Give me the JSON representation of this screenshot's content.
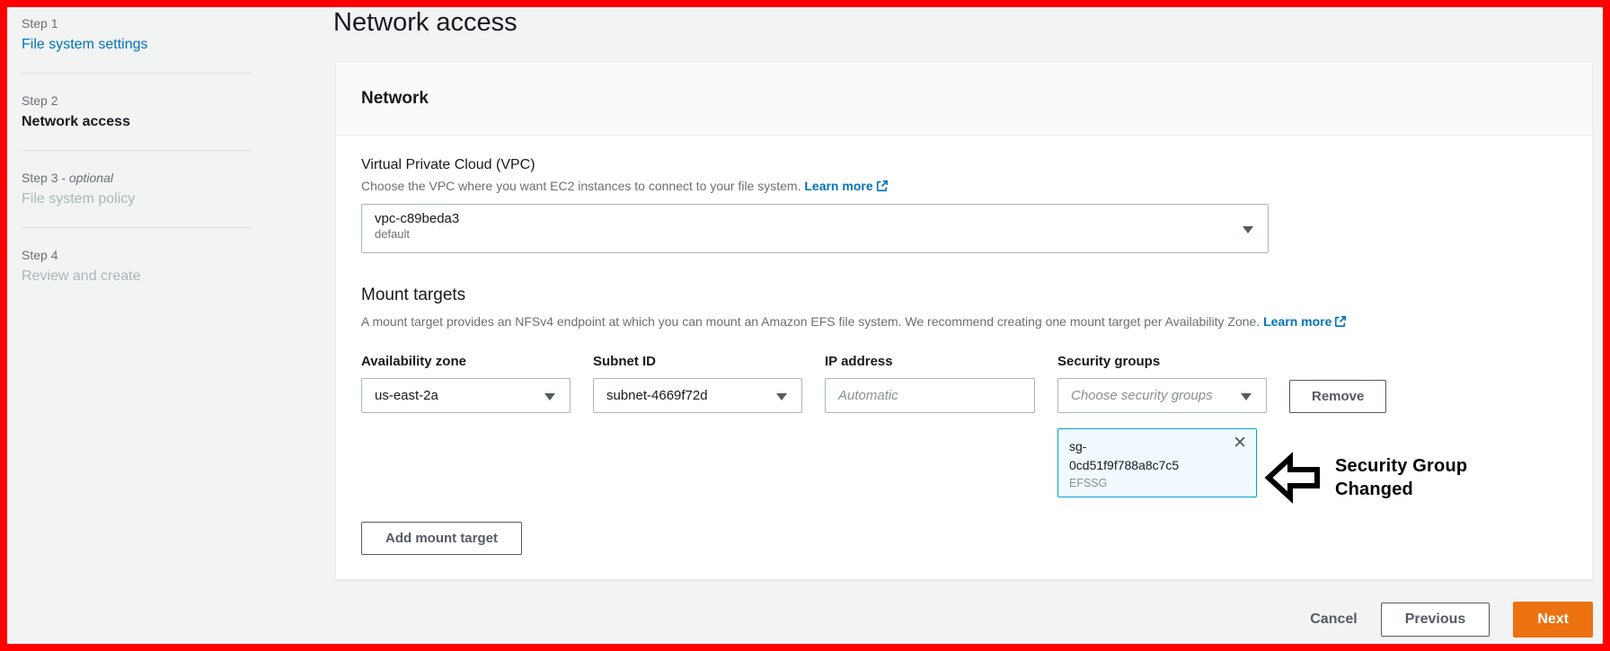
{
  "sidebar": {
    "steps": [
      {
        "step": "Step 1",
        "optional": "",
        "title": "File system settings"
      },
      {
        "step": "Step 2",
        "optional": "",
        "title": "Network access"
      },
      {
        "step": "Step 3 -",
        "optional": "optional",
        "title": "File system policy"
      },
      {
        "step": "Step 4",
        "optional": "",
        "title": "Review and create"
      }
    ]
  },
  "header": {
    "title": "Network access"
  },
  "network_card": {
    "title": "Network",
    "vpc": {
      "label": "Virtual Private Cloud (VPC)",
      "description": "Choose the VPC where you want EC2 instances to connect to your file system.",
      "learn_more": "Learn more",
      "value": "vpc-c89beda3",
      "value_sub": "default"
    },
    "mount_targets": {
      "title": "Mount targets",
      "description": "A mount target provides an NFSv4 endpoint at which you can mount an Amazon EFS file system. We recommend creating one mount target per Availability Zone.",
      "learn_more": "Learn more",
      "columns": [
        "Availability zone",
        "Subnet ID",
        "IP address",
        "Security groups"
      ],
      "row": {
        "availability_zone": "us-east-2a",
        "subnet_id": "subnet-4669f72d",
        "ip_placeholder": "Automatic",
        "sg_placeholder": "Choose security groups",
        "remove_label": "Remove"
      },
      "selected_group": {
        "line1": "sg-",
        "line2": "0cd51f9f788a8c7c5",
        "sub": "EFSSG"
      },
      "add_button": "Add mount target"
    }
  },
  "annotation": {
    "line1": "Security Group",
    "line2": "Changed"
  },
  "footer": {
    "cancel": "Cancel",
    "previous": "Previous",
    "next": "Next"
  },
  "icons": {
    "close": "✕"
  },
  "colors": {
    "frame_border": "#ff0000",
    "accent": "#ec7211",
    "link": "#0073bb",
    "chip_border": "#00a1c9",
    "chip_bg": "#f1faff"
  }
}
